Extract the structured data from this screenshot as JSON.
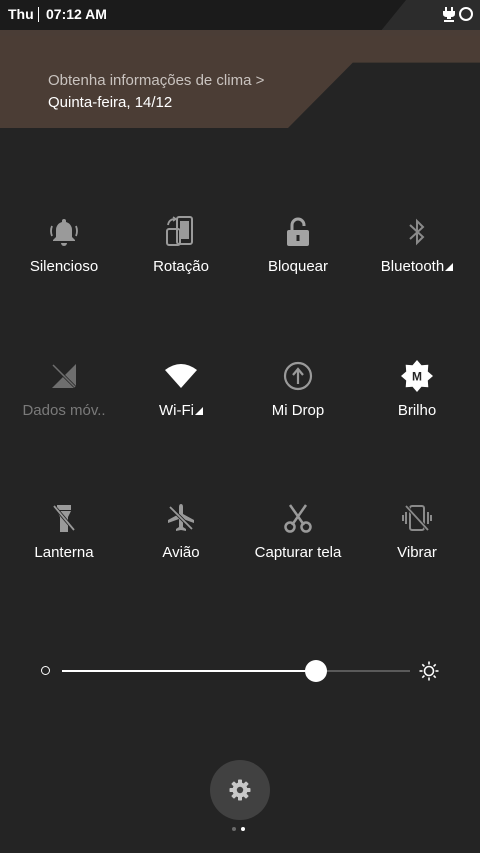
{
  "status_bar": {
    "day": "Thu",
    "time": "07:12 AM",
    "icons": [
      "charging-icon",
      "alarm-ring-icon"
    ]
  },
  "weather": {
    "link_text": "Obtenha informações de clima >",
    "date": "Quinta-feira, 14/12"
  },
  "tiles": [
    {
      "label": "Silencioso",
      "icon": "bell-icon",
      "active": true
    },
    {
      "label": "Rotação",
      "icon": "rotation-icon",
      "active": true
    },
    {
      "label": "Bloquear",
      "icon": "lock-icon",
      "active": true
    },
    {
      "label": "Bluetooth",
      "icon": "bluetooth-icon",
      "active": false,
      "has_more": true
    },
    {
      "label": "Dados móv..",
      "icon": "mobile-data-icon",
      "active": false
    },
    {
      "label": "Wi-Fi",
      "icon": "wifi-icon",
      "active": true,
      "has_more": true
    },
    {
      "label": "Mi Drop",
      "icon": "mi-drop-icon",
      "active": false
    },
    {
      "label": "Brilho",
      "icon": "auto-brightness-icon",
      "active": true
    },
    {
      "label": "Lanterna",
      "icon": "flashlight-icon",
      "active": false
    },
    {
      "label": "Avião",
      "icon": "airplane-icon",
      "active": false
    },
    {
      "label": "Capturar tela",
      "icon": "scissors-icon",
      "active": false
    },
    {
      "label": "Vibrar",
      "icon": "vibrate-icon",
      "active": false
    }
  ],
  "brightness": {
    "level": 0.73
  },
  "pager": {
    "pages": 2,
    "current": 2
  },
  "colors": {
    "background": "#242424",
    "banner": "#4b3d35",
    "active_icon": "#ffffff",
    "inactive_icon": "#8a8a8a"
  }
}
